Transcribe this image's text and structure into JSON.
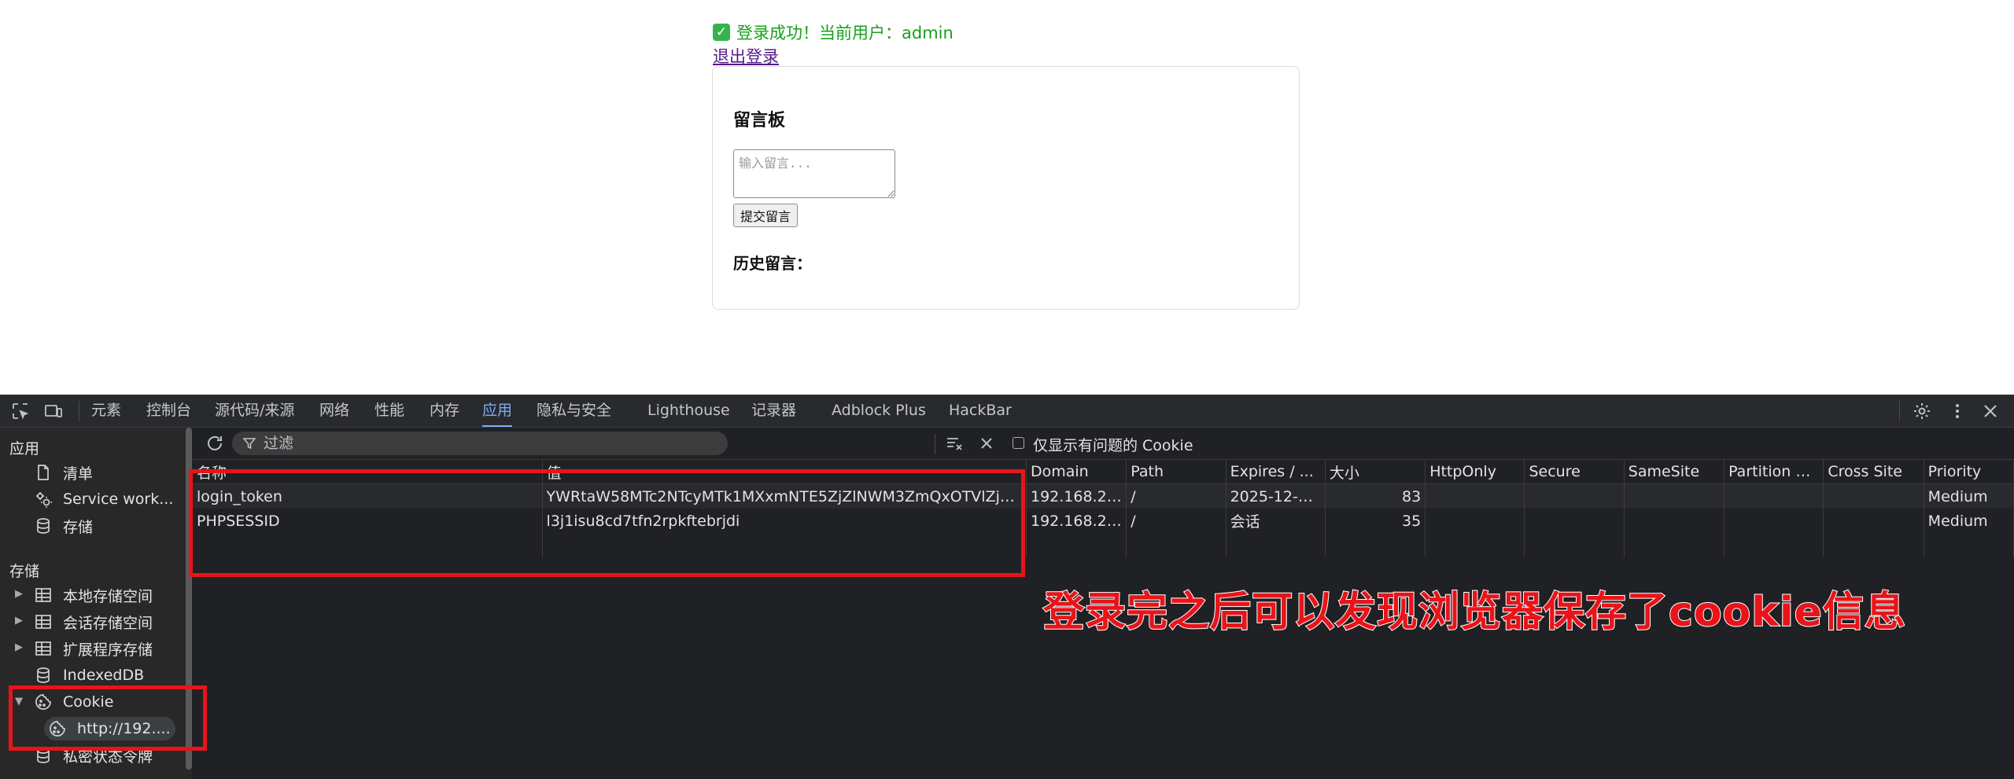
{
  "page": {
    "status_text": "登录成功！当前用户：admin",
    "logout_link": "退出登录",
    "board": {
      "title": "留言板",
      "input_placeholder": "输入留言...",
      "submit_label": "提交留言",
      "history_title": "历史留言："
    }
  },
  "devtools": {
    "tabs": [
      "元素",
      "控制台",
      "源代码/来源",
      "网络",
      "性能",
      "内存",
      "应用",
      "隐私与安全",
      "Lighthouse",
      "记录器",
      "Adblock Plus",
      "HackBar"
    ],
    "active_tab": "应用",
    "sidebar": {
      "section_app": "应用",
      "app_items": [
        "清单",
        "Service work...",
        "存储"
      ],
      "section_storage": "存储",
      "storage_items": [
        "本地存储空间",
        "会话存储空间",
        "扩展程序存储",
        "IndexedDB",
        "Cookie"
      ],
      "cookie_child": "http://192....",
      "extra_item": "私密状态令牌"
    },
    "toolbar": {
      "filter_placeholder": "过滤",
      "only_issues_label": "仅显示有问题的 Cookie"
    },
    "table": {
      "columns": [
        "名称",
        "值",
        "Domain",
        "Path",
        "Expires / ...",
        "大小",
        "HttpOnly",
        "Secure",
        "SameSite",
        "Partition K...",
        "Cross Site",
        "Priority"
      ],
      "rows": [
        {
          "name": "login_token",
          "value": "YWRtaW58MTc2NTcyMTk1MXxmNTE5ZjZlNWM3ZmQxOTVlZjg1...",
          "domain": "192.168.2....",
          "path": "/",
          "expires": "2025-12-1...",
          "size": "83",
          "httponly": "",
          "secure": "",
          "samesite": "",
          "partition": "",
          "cross_site": "",
          "priority": "Medium"
        },
        {
          "name": "PHPSESSID",
          "value": "l3j1isu8cd7tfn2rpkftebrjdi",
          "domain": "192.168.2....",
          "path": "/",
          "expires": "会话",
          "size": "35",
          "httponly": "",
          "secure": "",
          "samesite": "",
          "partition": "",
          "cross_site": "",
          "priority": "Medium"
        }
      ]
    }
  },
  "annotation": {
    "text": "登录完之后可以发现浏览器保存了cookie信息",
    "color": "#e8141a"
  },
  "colors": {
    "success_green": "#18a01a",
    "devtools_bg": "#202124",
    "active_tab_blue": "#7cacf8"
  }
}
